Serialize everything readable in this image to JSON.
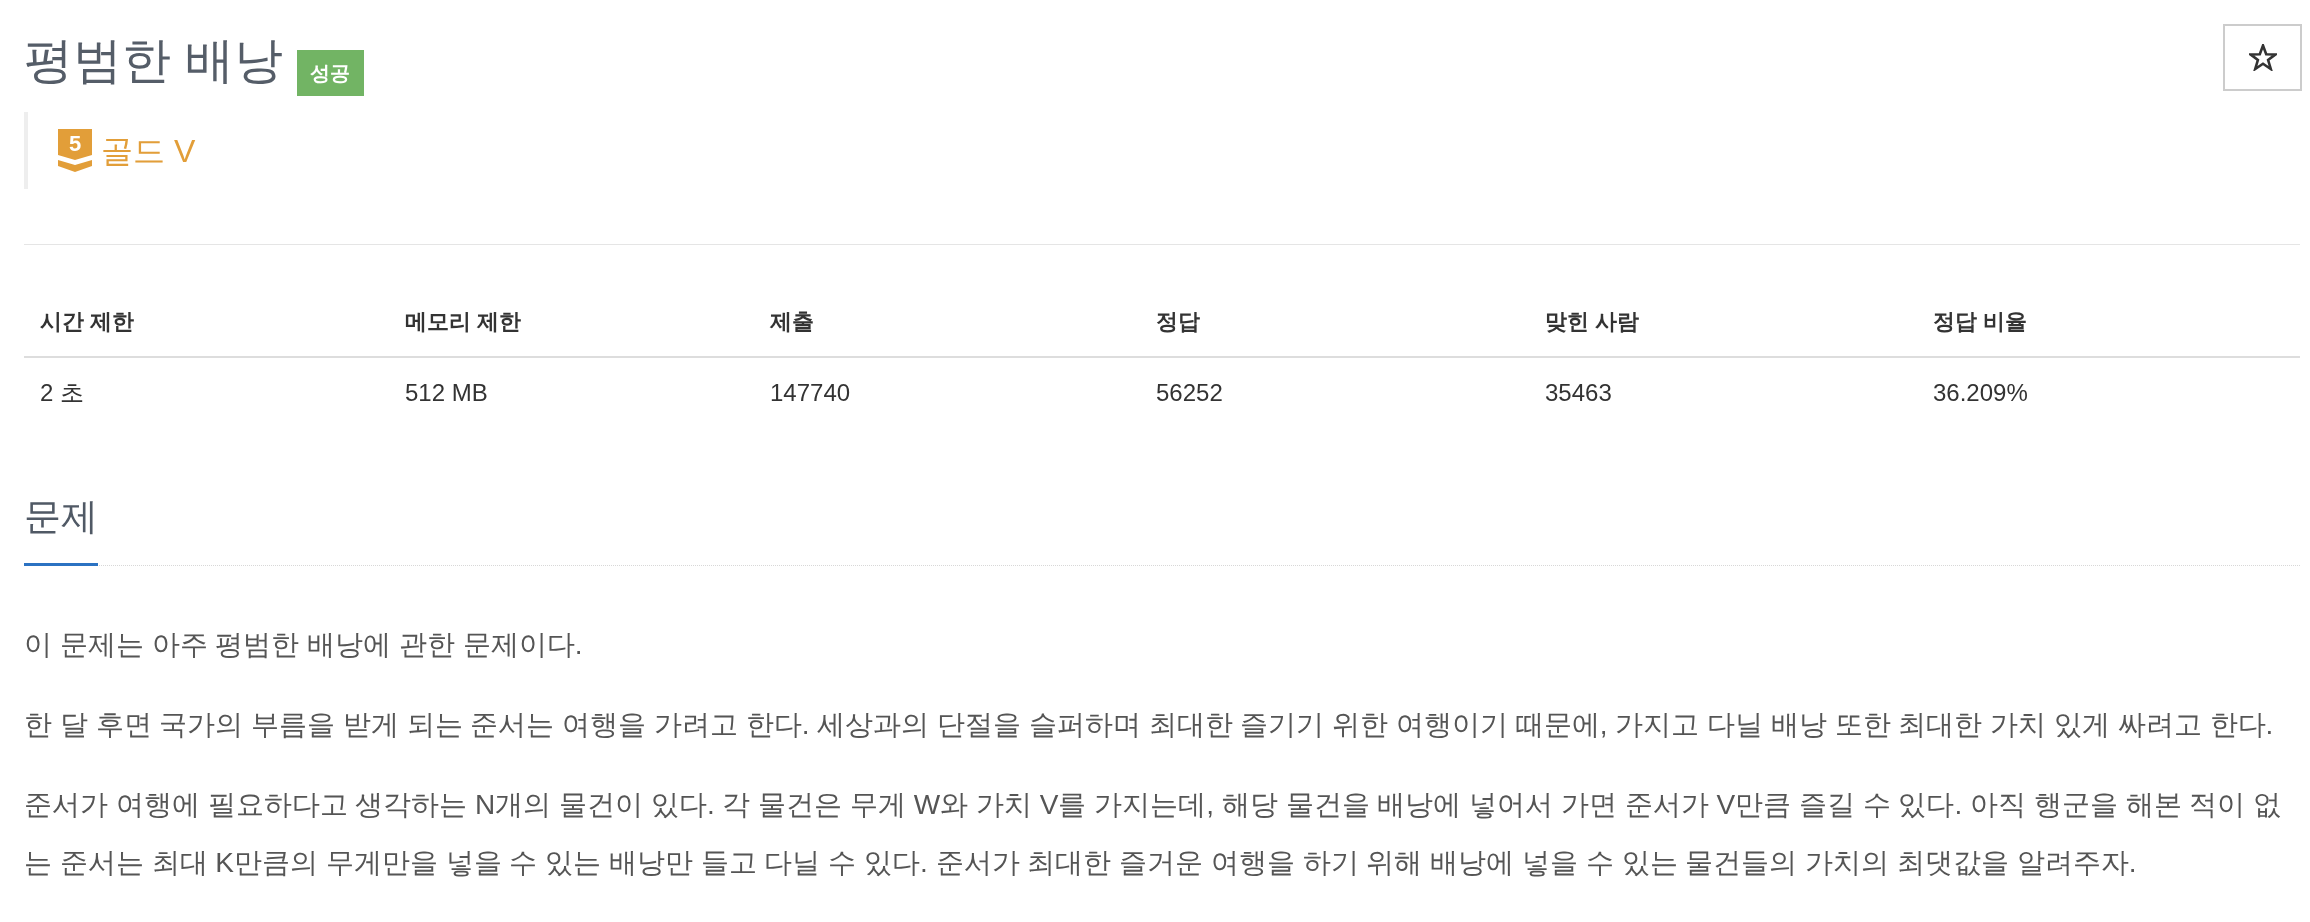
{
  "problem": {
    "title": "평범한 배낭",
    "result_badge": "성공",
    "starred": false
  },
  "tier": {
    "badge_number": "5",
    "name": "골드 V"
  },
  "stats_table": {
    "columns": [
      "시간 제한",
      "메모리 제한",
      "제출",
      "정답",
      "맞힌 사람",
      "정답 비율"
    ],
    "rows": [
      [
        "2 초",
        "512 MB",
        "147740",
        "56252",
        "35463",
        "36.209%"
      ]
    ]
  },
  "section": {
    "heading": "문제",
    "paragraphs": [
      "이 문제는 아주 평범한 배낭에 관한 문제이다.",
      "한 달 후면 국가의 부름을 받게 되는 준서는 여행을 가려고 한다. 세상과의 단절을 슬퍼하며 최대한 즐기기 위한 여행이기 때문에, 가지고 다닐 배낭 또한 최대한 가치 있게 싸려고 한다.",
      "준서가 여행에 필요하다고 생각하는 N개의 물건이 있다. 각 물건은 무게 W와 가치 V를 가지는데, 해당 물건을 배낭에 넣어서 가면 준서가 V만큼 즐길 수 있다. 아직 행군을 해본 적이 없는 준서는 최대 K만큼의 무게만을 넣을 수 있는 배낭만 들고 다닐 수 있다. 준서가 최대한 즐거운 여행을 하기 위해 배낭에 넣을 수 있는 물건들의 가치의 최댓값을 알려주자."
    ]
  }
}
